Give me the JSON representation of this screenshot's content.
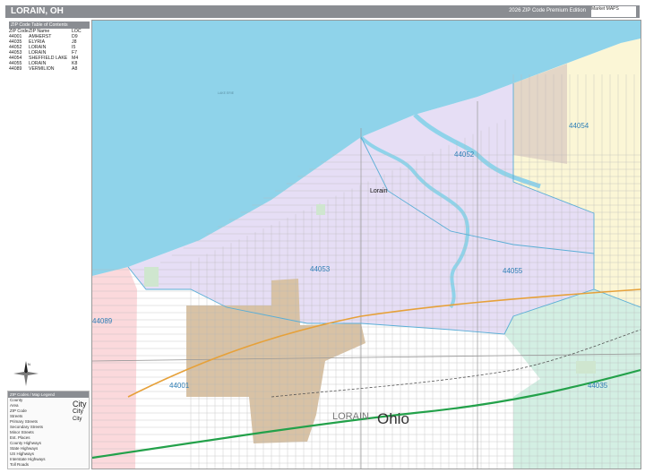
{
  "header": {
    "title": "LORAIN, OH",
    "edition": "2026 ZIP Code Premium Edition",
    "logo_text": "Market MAPS"
  },
  "zip_table": {
    "title": "ZIP Code Table of Contents",
    "columns": [
      "ZIP Code",
      "ZIP Name",
      "LOC"
    ],
    "rows": [
      [
        "44001",
        "AMHERST",
        "D9"
      ],
      [
        "44035",
        "ELYRIA",
        "J8"
      ],
      [
        "44052",
        "LORAIN",
        "I5"
      ],
      [
        "44053",
        "LORAIN",
        "F7"
      ],
      [
        "44054",
        "SHEFFIELD LAKE",
        "M4"
      ],
      [
        "44055",
        "LORAIN",
        "K8"
      ],
      [
        "44089",
        "VERMILION",
        "A8"
      ]
    ]
  },
  "map": {
    "city_label": "Lorain",
    "county_label": "LORAIN",
    "state_label": "Ohio",
    "lake_label": "LAKE ERIE",
    "zip_labels": [
      "44054",
      "44052",
      "44053",
      "44055",
      "44089",
      "44001",
      "44035"
    ],
    "colors": {
      "water": "#8fd3ea",
      "zip_44052_44053": "#e6def5",
      "zip_44054_east": "#fbf6d6",
      "zip_44054_west": "#e3d6c7",
      "zip_44001": "#d8c2a5",
      "zip_44035": "#d3efe3",
      "zip_44089": "#fbd9dc",
      "road": "#b8b8b8",
      "highway": "#e6a13a",
      "interstate": "#23a14a",
      "rail": "#555555",
      "zip_boundary": "#5aaed6"
    }
  },
  "compass": {
    "label": "N"
  },
  "legend": {
    "title": "ZIP Codes / Map Legend",
    "items": [
      "County",
      "Area",
      "ZIP Code",
      "Streets",
      "Primary Streets",
      "Secondary Streets",
      "Minor Streets",
      "Est. Places",
      "County Highways",
      "State Highways",
      "US Highways",
      "Interstate Highways",
      "Toll Roads"
    ],
    "city_samples": [
      "City",
      "City",
      "City"
    ]
  }
}
